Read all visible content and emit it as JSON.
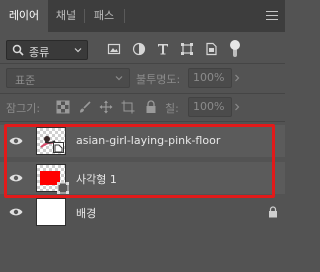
{
  "tabs": [
    {
      "label": "레이어",
      "active": true
    },
    {
      "label": "채널",
      "active": false
    },
    {
      "label": "패스",
      "active": false
    }
  ],
  "filter": {
    "kind_label": "종류",
    "icons": [
      "image-filter-icon",
      "adjustment-filter-icon",
      "type-filter-icon",
      "shape-filter-icon",
      "smart-object-filter-icon"
    ]
  },
  "blend": {
    "mode": "표준",
    "opacity_label": "불투명도:",
    "opacity_value": "100%"
  },
  "lock": {
    "label": "잠그기:",
    "fill_label": "칠:",
    "fill_value": "100%"
  },
  "layers": [
    {
      "name": "asian-girl-laying-pink-floor",
      "type": "smart-object",
      "visible": true,
      "selected": true
    },
    {
      "name": "사각형 1",
      "type": "shape",
      "visible": true,
      "selected": true
    },
    {
      "name": "배경",
      "type": "background",
      "visible": true,
      "selected": false,
      "locked": true
    }
  ],
  "colors": {
    "highlight": "#e21a1a",
    "shape_fill": "#ff0000",
    "panel_bg": "#535353"
  }
}
